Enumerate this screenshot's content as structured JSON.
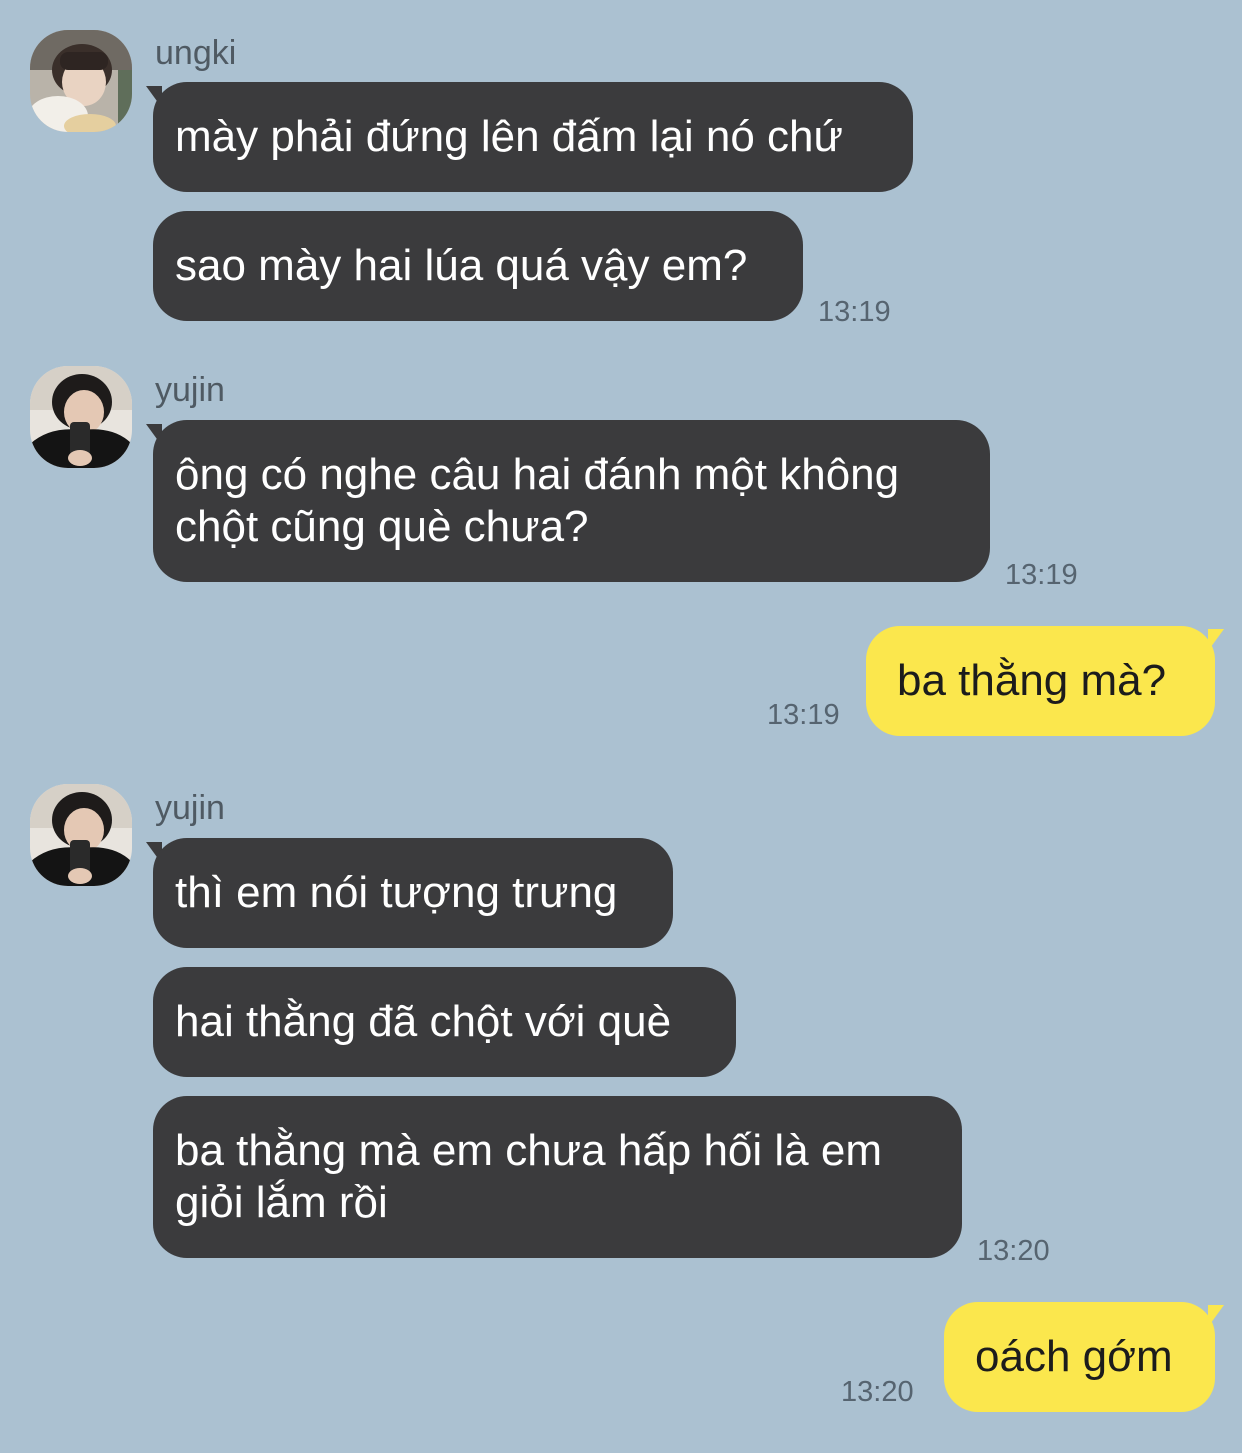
{
  "colors": {
    "background": "#abc1d1",
    "incoming_bubble": "#3b3b3d",
    "outgoing_bubble": "#fbe74d"
  },
  "messages": [
    {
      "sender": "ungki",
      "direction": "incoming",
      "avatar": "avatar-ungki",
      "bubbles": [
        "mày phải đứng lên đấm lại nó chứ",
        "sao mày hai lúa quá vậy em?"
      ],
      "time": "13:19"
    },
    {
      "sender": "yujin",
      "direction": "incoming",
      "avatar": "avatar-yujin",
      "bubbles": [
        "ông có nghe câu hai đánh một không",
        "chột cũng què chưa?"
      ],
      "time": "13:19"
    },
    {
      "sender": "",
      "direction": "outgoing",
      "bubbles": [
        "ba thằng mà?"
      ],
      "time": "13:19"
    },
    {
      "sender": "yujin",
      "direction": "incoming",
      "avatar": "avatar-yujin",
      "bubbles": [
        "thì em nói tượng trưng",
        "hai thằng đã chột với què",
        "ba thằng mà em chưa hấp hối là em",
        "giỏi lắm rồi"
      ],
      "time": "13:20"
    },
    {
      "sender": "",
      "direction": "outgoing",
      "bubbles": [
        "oách gớm"
      ],
      "time": "13:20"
    }
  ]
}
